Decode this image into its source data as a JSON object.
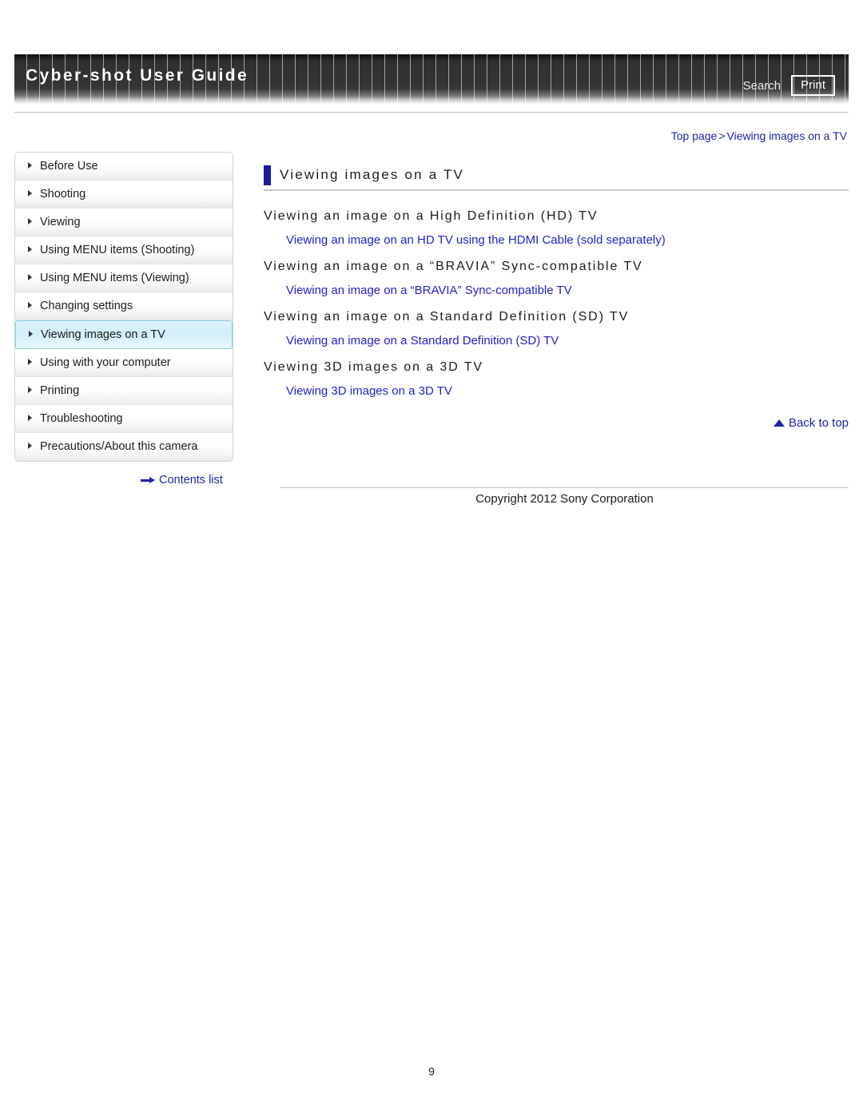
{
  "header": {
    "site_title": "Cyber-shot User Guide",
    "search_label": "Search",
    "print_label": "Print"
  },
  "breadcrumb": {
    "top": "Top page",
    "separator": ">",
    "current": "Viewing images on a TV"
  },
  "sidebar": {
    "items": [
      {
        "label": "Before Use",
        "active": false
      },
      {
        "label": "Shooting",
        "active": false
      },
      {
        "label": "Viewing",
        "active": false
      },
      {
        "label": "Using MENU items (Shooting)",
        "active": false
      },
      {
        "label": "Using MENU items (Viewing)",
        "active": false
      },
      {
        "label": "Changing settings",
        "active": false
      },
      {
        "label": "Viewing images on a TV",
        "active": true
      },
      {
        "label": "Using with your computer",
        "active": false
      },
      {
        "label": "Printing",
        "active": false
      },
      {
        "label": "Troubleshooting",
        "active": false
      },
      {
        "label": "Precautions/About this camera",
        "active": false
      }
    ],
    "contents_list_label": "Contents list"
  },
  "main": {
    "page_title": "Viewing images on a TV",
    "sections": [
      {
        "heading": "Viewing an image on a High Definition (HD) TV",
        "link": "Viewing an image on an HD TV using the HDMI Cable (sold separately)"
      },
      {
        "heading": "Viewing an image on a “BRAVIA” Sync-compatible TV",
        "link": "Viewing an image on a “BRAVIA” Sync-compatible TV"
      },
      {
        "heading": "Viewing an image on a Standard Definition (SD) TV",
        "link": "Viewing an image on a Standard Definition (SD) TV"
      },
      {
        "heading": "Viewing 3D images on a 3D TV",
        "link": "Viewing 3D images on a 3D TV"
      }
    ],
    "back_to_top_label": "Back to top"
  },
  "footer": {
    "copyright": "Copyright 2012 Sony Corporation",
    "page_number": "9"
  },
  "colors": {
    "link_blue": "#2222cc",
    "breadcrumb_blue": "#2222a8",
    "title_bar_blue": "#1a1a9c",
    "active_nav_border": "#7fd0e4"
  }
}
